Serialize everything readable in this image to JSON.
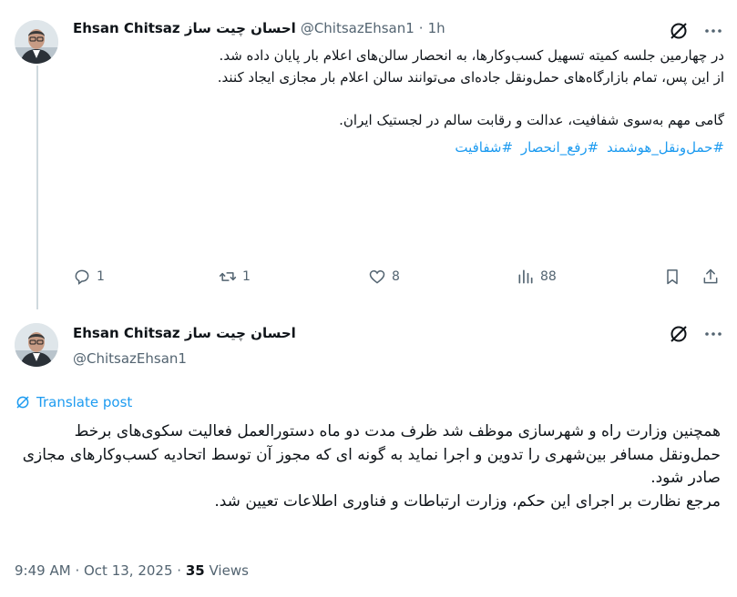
{
  "tweet1": {
    "display_name": "Ehsan Chitsaz احسان چیت ساز",
    "handle": "@ChitsazEhsan1",
    "separator": "·",
    "time": "1h",
    "text_lines": [
      "در چهارمین جلسه کمیته تسهیل کسب‌وکارها، به انحصار سالن‌های اعلام بار پایان داده شد.",
      "از این پس، تمام بازارگاه‌های حمل‌ونقل جاده‌ای می‌توانند سالن  اعلام بار مجازی ایجاد کنند.",
      "گامی مهم به‌سوی شفافیت، عدالت و رقابت سالم در لجستیک ایران."
    ],
    "hashtags": [
      "#حمل‌ونقل_هوشمند",
      "#رفع_انحصار",
      "#شفافیت"
    ],
    "actions": {
      "replies": "1",
      "reposts": "1",
      "likes": "8",
      "views": "88"
    }
  },
  "tweet2": {
    "display_name": "Ehsan Chitsaz احسان چیت ساز",
    "handle": "@ChitsazEhsan1",
    "translate_label": "Translate post",
    "text_lines": [
      "همچنین وزارت راه و شهرسازی موظف شد ظرف مدت دو ماه دستورالعمل فعالیت سکوی‌های برخط حمل‌ونقل مسافر بین‌شهری را تدوین و اجرا نماید به گونه ای که مجوز آن  توسط اتحادیه کسب‌وکارهای مجازی صادر شود.",
      "مرجع نظارت بر اجرای این حکم، وزارت ارتباطات و فناوری اطلاعات تعیین شد."
    ],
    "time": "9:49 AM",
    "date": "Oct 13, 2025",
    "separator": "·",
    "views_count": "35",
    "views_label": "Views"
  },
  "icons": {
    "grok": "grok-icon",
    "more": "more-dots-icon",
    "reply": "reply-icon",
    "repost": "repost-icon",
    "like": "heart-icon",
    "views": "views-chart-icon",
    "bookmark": "bookmark-icon",
    "share": "share-icon",
    "translate": "translate-icon"
  },
  "colors": {
    "text": "#0f1419",
    "muted": "#536471",
    "link": "#1d9bf0",
    "thread_line": "#cfd9de"
  }
}
